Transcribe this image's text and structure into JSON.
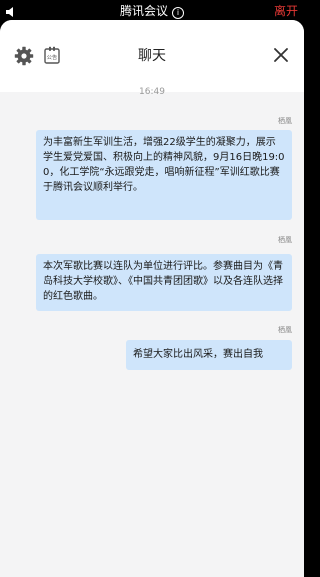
{
  "status_bar": {
    "app_title": "腾讯会议",
    "info_symbol": "i",
    "leave_label": "离开"
  },
  "chat": {
    "title": "聊天",
    "notice_label": "公告",
    "timestamp": "16:49",
    "messages": [
      {
        "sender": "栖凰",
        "text": "为丰富新生军训生活，增强22级学生的凝聚力，展示学生爱党爱国、积极向上的精神风貌，9月16日晚19:00，化工学院“永远跟党走，唱响新征程”军训红歌比赛于腾讯会议顺利举行。"
      },
      {
        "sender": "栖凰",
        "text": "本次军歌比赛以连队为单位进行评比。参赛曲目为《青岛科技大学校歌》、《中国共青团团歌》以及各连队选择的红色歌曲。"
      },
      {
        "sender": "栖凰",
        "text": "希望大家比出风采，赛出自我"
      }
    ]
  },
  "icons": {
    "speaker": "speaker-icon",
    "info": "info-icon",
    "settings": "gear-icon",
    "notice": "notice-board-icon",
    "close": "close-icon"
  },
  "colors": {
    "leave": "#e53935",
    "bubble": "#cfe5fb",
    "background": "#f4f4f5"
  }
}
